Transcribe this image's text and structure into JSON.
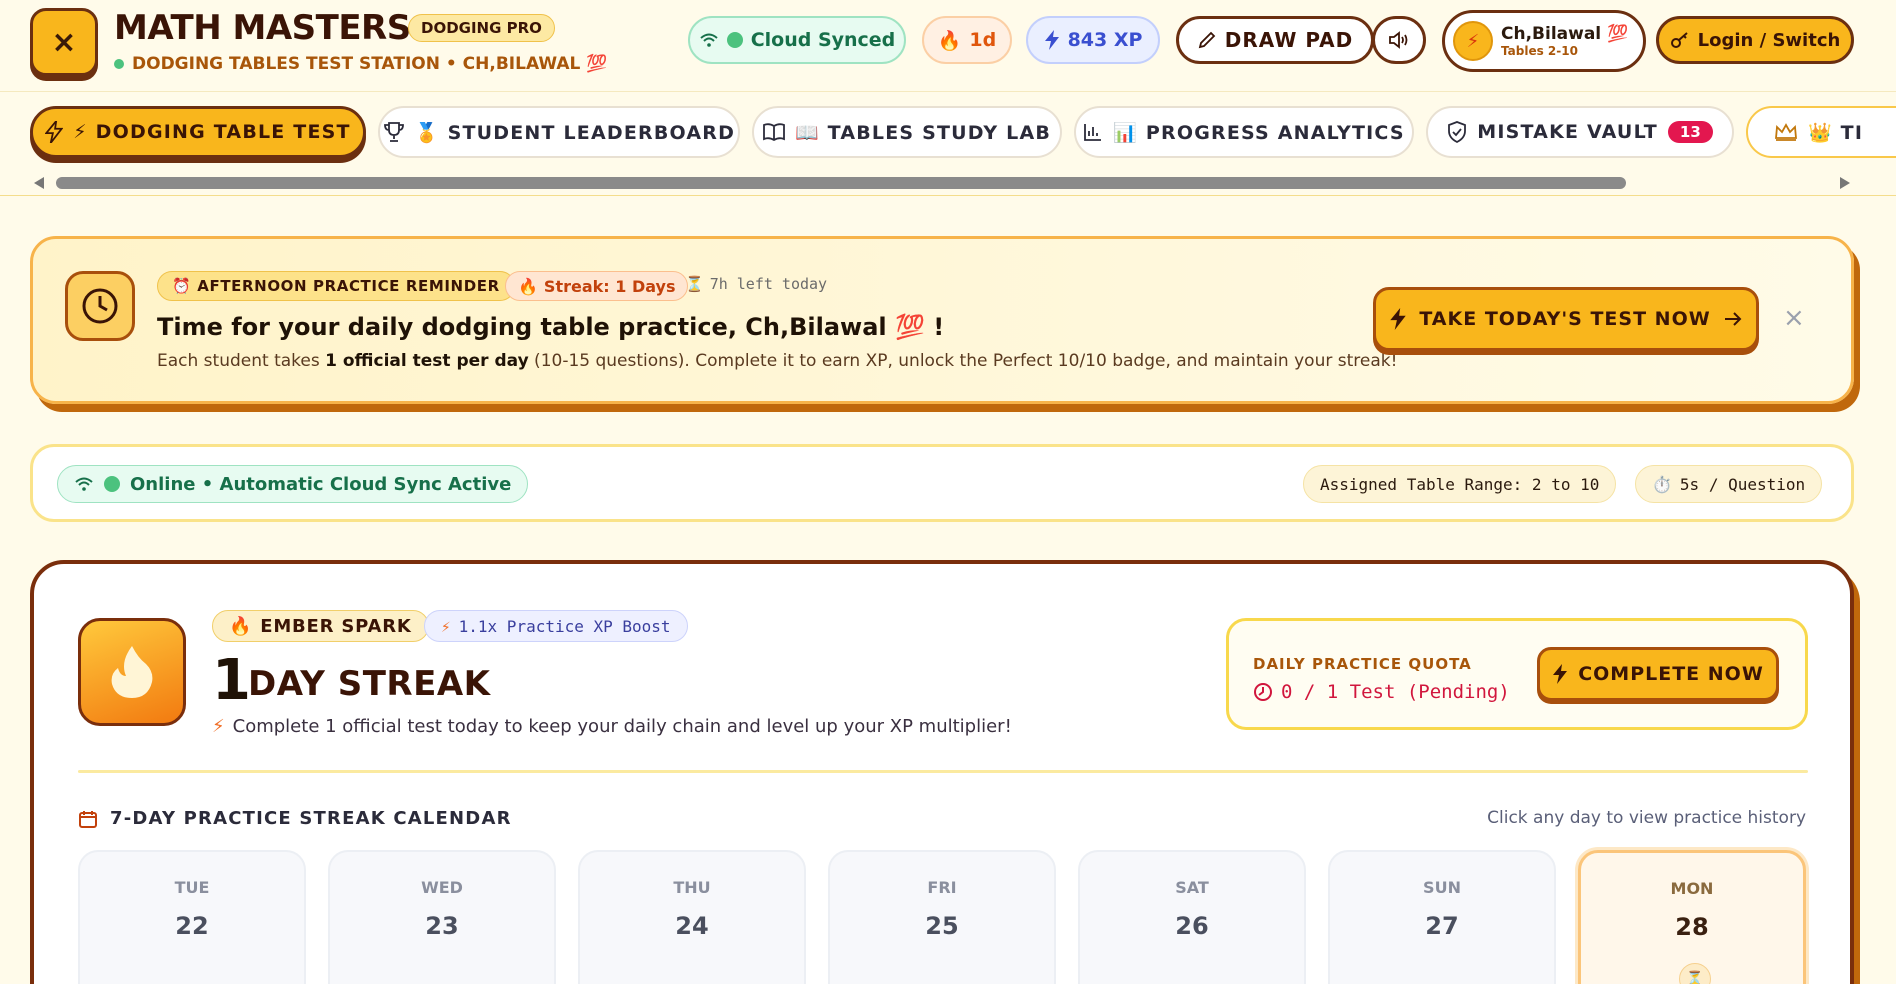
{
  "header": {
    "close_glyph": "×",
    "title": "MATH MASTERS",
    "badge": "DODGING PRO",
    "subtitle": "DODGING TABLES TEST STATION • CH,BILAWAL 💯",
    "cloud_status": "Cloud Synced",
    "streak": "1d",
    "xp": "843 XP",
    "draw_pad": "DRAW PAD",
    "user_name": "Ch,Bilawal 💯",
    "user_tables": "Tables 2-10",
    "login": "Login / Switch"
  },
  "nav": {
    "tabs": [
      {
        "label": "⚡ DODGING TABLE TEST",
        "icon": "bolt-icon",
        "active": true
      },
      {
        "label": "🏅 STUDENT LEADERBOARD",
        "icon": "trophy-icon"
      },
      {
        "label": "📖 TABLES STUDY LAB",
        "icon": "book-icon"
      },
      {
        "label": "📊 PROGRESS ANALYTICS",
        "icon": "bar-chart-icon"
      },
      {
        "label": "MISTAKE VAULT",
        "icon": "shield-icon",
        "count": "13"
      },
      {
        "label": "👑 TI",
        "icon": "crown-icon"
      }
    ]
  },
  "reminder": {
    "tag": "AFTERNOON PRACTICE REMINDER",
    "streak_tag": "Streak: 1 Days",
    "time_left": "7h left today",
    "title": "Time for your daily dodging table practice, Ch,Bilawal 💯 !",
    "desc_pre": "Each student takes ",
    "desc_bold": "1 official test per day",
    "desc_post": " (10-15 questions). Complete it to earn XP, unlock the Perfect 10/10 badge, and maintain your streak!",
    "cta": "TAKE TODAY'S TEST NOW",
    "close": "×"
  },
  "status": {
    "online": "Online • Automatic Cloud Sync Active",
    "range": "Assigned Table Range: 2 to 10",
    "time": "5s / Question"
  },
  "streak": {
    "tier": "EMBER SPARK",
    "boost": "1.1x Practice XP Boost",
    "count": "1",
    "label": "DAY STREAK",
    "hint": "Complete 1 official test today to keep your daily chain and level up your XP multiplier!",
    "quota_label": "DAILY PRACTICE QUOTA",
    "quota_value": "0 / 1 Test (Pending)",
    "quota_button": "COMPLETE NOW"
  },
  "calendar": {
    "title": "7-DAY PRACTICE STREAK CALENDAR",
    "hint": "Click any day to view practice history",
    "days": [
      {
        "name": "TUE",
        "num": "22"
      },
      {
        "name": "WED",
        "num": "23"
      },
      {
        "name": "THU",
        "num": "24"
      },
      {
        "name": "FRI",
        "num": "25"
      },
      {
        "name": "SAT",
        "num": "26"
      },
      {
        "name": "SUN",
        "num": "27"
      },
      {
        "name": "MON",
        "num": "28",
        "today": true
      }
    ]
  },
  "colors": {
    "accent": "#f9b61c",
    "border_dark": "#6b2f10",
    "background": "#fffbea",
    "success": "#17704a",
    "danger": "#e3174f"
  }
}
